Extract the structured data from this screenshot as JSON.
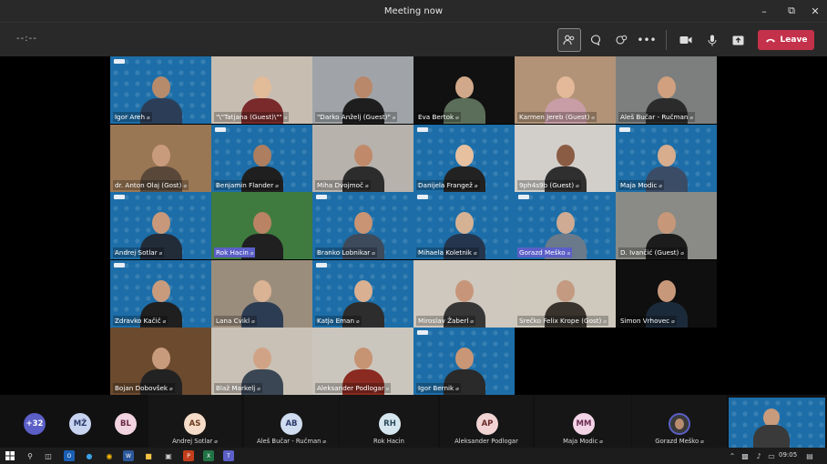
{
  "window": {
    "title": "Meeting now"
  },
  "toolbar": {
    "timer": "--:--",
    "leave_label": "Leave"
  },
  "participants": [
    {
      "name": "Igor Areh",
      "bg": "pattern",
      "head": "#b68b6b",
      "shirt": "#2c3e57"
    },
    {
      "name": "\"\\\"Tatjana (Guest)\\\"\"",
      "bg": "#c8bdb1",
      "head": "#e2bb99",
      "shirt": "#7a2a2a"
    },
    {
      "name": "\"Darko Anželj (Guest)\"",
      "bg": "#a0a4a8",
      "head": "#b9876a",
      "shirt": "#1e1e1e"
    },
    {
      "name": "Eva Bertok",
      "bg": "#111111",
      "head": "#d1a98a",
      "shirt": "#5b6e59"
    },
    {
      "name": "Karmen Jereb (Guest)",
      "bg": "#b29377",
      "head": "#e3b99a",
      "shirt": "#c89da6"
    },
    {
      "name": "Aleš Bučar - Ručman",
      "bg": "#7d7f7f",
      "head": "#d0a07f",
      "shirt": "#2b2b2b"
    },
    {
      "name": "dr. Anton Olaj (Gost)",
      "bg": "#9a7754",
      "head": "#c99b7d",
      "shirt": "#59483a"
    },
    {
      "name": "Benjamin Flander",
      "bg": "pattern",
      "head": "#ad7e60",
      "shirt": "#1f1f1f"
    },
    {
      "name": "Miha Dvojmoč",
      "bg": "#b7b2ac",
      "head": "#c08a6a",
      "shirt": "#2c2c2c"
    },
    {
      "name": "Danijela Frangež",
      "bg": "pattern",
      "head": "#e7c0a0",
      "shirt": "#222222"
    },
    {
      "name": "9ph4s9b (Guest)",
      "bg": "#d2cfcb",
      "head": "#8a5c44",
      "shirt": "#2f2f2f"
    },
    {
      "name": "Maja Modic",
      "bg": "pattern",
      "head": "#d7ad8d",
      "shirt": "#3b4c66"
    },
    {
      "name": "Andrej Sotlar",
      "bg": "pattern",
      "head": "#c7987a",
      "shirt": "#222b38"
    },
    {
      "name": "Rok Hacin",
      "bg": "#3f7b3f",
      "head": "#b98364",
      "shirt": "#202020",
      "highlight": true
    },
    {
      "name": "Branko Lobnikar",
      "bg": "pattern",
      "head": "#c99474",
      "shirt": "#3d4a5c"
    },
    {
      "name": "Mihaela Koletnik",
      "bg": "pattern",
      "head": "#d6b295",
      "shirt": "#24364d"
    },
    {
      "name": "Gorazd Meško",
      "bg": "pattern",
      "head": "#ceab92",
      "shirt": "#6b7a8a",
      "highlight": true
    },
    {
      "name": "D. Ivančić (Guest)",
      "bg": "#8a8a86",
      "head": "#c69879",
      "shirt": "#1c1c1c"
    },
    {
      "name": "Zdravko Kačič",
      "bg": "pattern",
      "head": "#c99b7d",
      "shirt": "#1f1f1f"
    },
    {
      "name": "Lana Cvikl",
      "bg": "#9b8d7c",
      "head": "#dab294",
      "shirt": "#2c3c52"
    },
    {
      "name": "Katja Eman",
      "bg": "pattern",
      "head": "#d9b091",
      "shirt": "#2d2d2d"
    },
    {
      "name": "Miroslav Žaberl",
      "bg": "#cfc8bf",
      "head": "#c7967a",
      "shirt": "#363636"
    },
    {
      "name": "Srečko Felix Krope (Gost)",
      "bg": "#cfc8bd",
      "head": "#c49a80",
      "shirt": "#38332c"
    },
    {
      "name": "Simon Vrhovec",
      "bg": "#0f0f0f",
      "head": "#c8987a",
      "shirt": "#1b2a3a"
    },
    {
      "name": "Bojan Dobovšek",
      "bg": "#6b4a2e",
      "head": "#c99b7d",
      "shirt": "#222222"
    },
    {
      "name": "Blaž Markelj",
      "bg": "#c9c1b6",
      "head": "#d1a386",
      "shirt": "#3b4654"
    },
    {
      "name": "Aleksander Podlogar",
      "bg": "#cbc6bd",
      "head": "#c69373",
      "shirt": "#8a2a20"
    },
    {
      "name": "Igor Bernik",
      "bg": "pattern",
      "head": "#c99676",
      "shirt": "#2a2a2a"
    }
  ],
  "tray": [
    {
      "initials": "+32",
      "label": "",
      "color": "#5b5fc7",
      "text": "#ffffff",
      "mic": false
    },
    {
      "initials": "MŽ",
      "label": "",
      "color": "#c7d3ef",
      "text": "#2a3a6a",
      "mic": false
    },
    {
      "initials": "BL",
      "label": "",
      "color": "#f2d4e0",
      "text": "#6a2a44",
      "mic": false
    },
    {
      "initials": "AS",
      "label": "Andrej Sotlar",
      "color": "#f5dcc8",
      "text": "#6a3a20",
      "mic": true
    },
    {
      "initials": "AB",
      "label": "Aleš Bučar - Ručman",
      "color": "#d0dcef",
      "text": "#2a3a6a",
      "mic": true
    },
    {
      "initials": "RH",
      "label": "Rok Hacin",
      "color": "#d6e6ef",
      "text": "#2a4a5a",
      "mic": false
    },
    {
      "initials": "AP",
      "label": "Aleksander Podlogar",
      "color": "#f2d4d4",
      "text": "#6a2a2a",
      "mic": false
    },
    {
      "initials": "MM",
      "label": "Maja Modic",
      "color": "#f2d4e6",
      "text": "#6a2a50",
      "mic": true
    },
    {
      "initials": "",
      "label": "Gorazd Meško",
      "color": "#3a3a3a",
      "text": "#ffffff",
      "mic": true
    }
  ],
  "taskbar": {
    "time": "09:05"
  }
}
